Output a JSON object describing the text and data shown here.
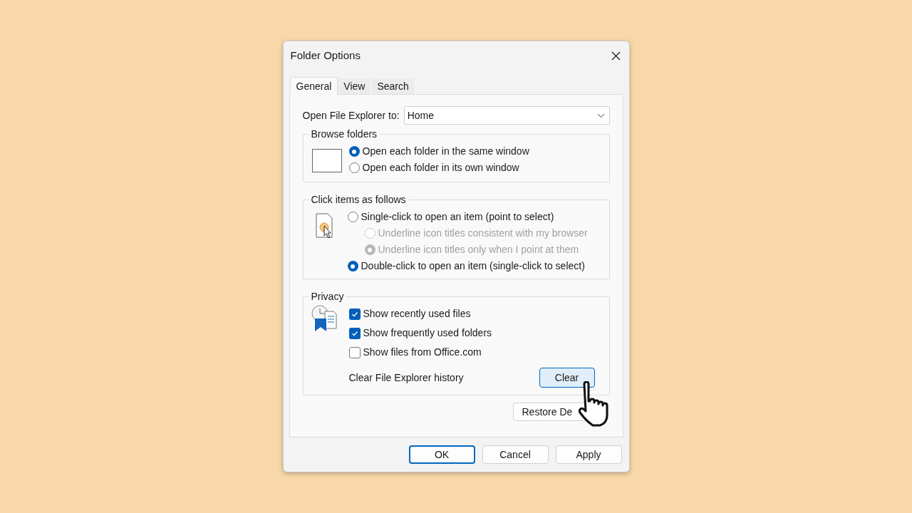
{
  "window": {
    "title": "Folder Options"
  },
  "tabs": [
    {
      "label": "General",
      "selected": true
    },
    {
      "label": "View",
      "selected": false
    },
    {
      "label": "Search",
      "selected": false
    }
  ],
  "open_to": {
    "label": "Open File Explorer to:",
    "value": "Home"
  },
  "browse_folders": {
    "title": "Browse folders",
    "options": [
      {
        "label": "Open each folder in the same window",
        "selected": true
      },
      {
        "label": "Open each folder in its own window",
        "selected": false
      }
    ]
  },
  "click_items": {
    "title": "Click items as follows",
    "options": [
      {
        "label": "Single-click to open an item (point to select)",
        "selected": false,
        "children": [
          {
            "label": "Underline icon titles consistent with my browser",
            "selected": false,
            "disabled": true
          },
          {
            "label": "Underline icon titles only when I point at them",
            "selected": true,
            "disabled": true
          }
        ]
      },
      {
        "label": "Double-click to open an item (single-click to select)",
        "selected": true
      }
    ]
  },
  "privacy": {
    "title": "Privacy",
    "checkboxes": [
      {
        "label": "Show recently used files",
        "checked": true
      },
      {
        "label": "Show frequently used folders",
        "checked": true
      },
      {
        "label": "Show files from Office.com",
        "checked": false
      }
    ],
    "clear_label": "Clear File Explorer history",
    "clear_button": "Clear"
  },
  "restore_button": "Restore De",
  "buttons": [
    {
      "label": "OK",
      "default": true
    },
    {
      "label": "Cancel",
      "default": false
    },
    {
      "label": "Apply",
      "default": false
    }
  ]
}
